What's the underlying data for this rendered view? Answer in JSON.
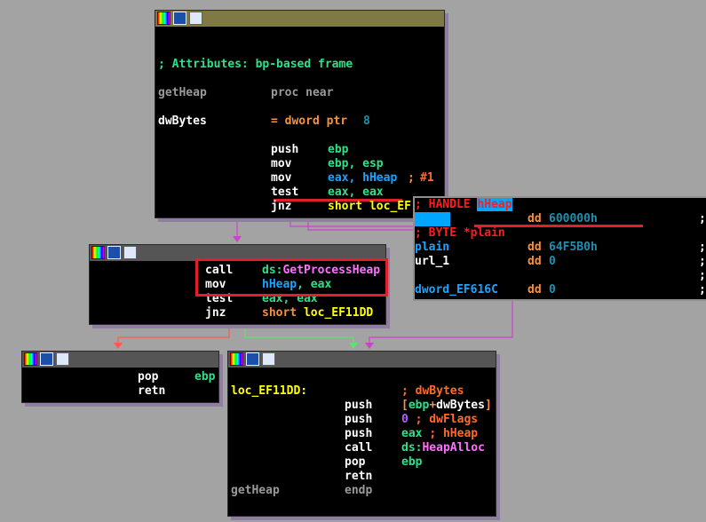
{
  "icons": [
    "color-palette-icon",
    "edit-pencil-icon",
    "graph-view-icon"
  ],
  "colors": {
    "background": "#a3a3a3",
    "node_title_active": "#7f7a45",
    "node_title": "#555555",
    "highlight_box": "#e0202a"
  },
  "node1": {
    "comment": "; Attributes: bp-based frame",
    "proc_name": "getHeap",
    "proc_kw": "proc near",
    "var": "dwBytes",
    "var_def": "= dword ptr",
    "var_off": "8",
    "lines": [
      [
        "push",
        "ebp"
      ],
      [
        "mov",
        "ebp, esp"
      ],
      [
        "mov",
        "eax, hHeap"
      ],
      [
        "test",
        "eax, eax"
      ],
      [
        "jnz",
        "short loc_EF"
      ]
    ],
    "cursor_comment": ";",
    "cursor_num": "#1"
  },
  "popup": {
    "c1": "; HANDLE",
    "c1_name": "hHeap",
    "dd": "dd",
    "v1": "600000h",
    "c2": "; BYTE *plain",
    "n2": "plain",
    "v2": "64F5B0h",
    "n3": "url_1",
    "v3": "0",
    "n4": "dword_EF616C",
    "v4": "0",
    "semi": ";"
  },
  "node3": {
    "lines": [
      [
        "call",
        "ds:",
        "GetProcessHeap"
      ],
      [
        "mov",
        "hHeap",
        ", eax"
      ],
      [
        "test",
        "eax, eax"
      ],
      [
        "jnz",
        "short ",
        "loc_EF11DD"
      ]
    ]
  },
  "node4": {
    "lines": [
      [
        "pop",
        "ebp"
      ],
      [
        "retn",
        ""
      ]
    ]
  },
  "node5": {
    "label": "loc_EF11DD:",
    "c_bytes": "; dwBytes",
    "push1": "push",
    "op1a": "[",
    "op1b": "ebp",
    "op1c": "+",
    "op1d": "dwBytes",
    "op1e": "]",
    "push2": "push",
    "op2": "0",
    "op2c": "; dwFlags",
    "push3": "push",
    "op3": "eax",
    "op3c": "; hHeap",
    "call": "call",
    "op4a": "ds:",
    "op4b": "HeapAlloc",
    "pop": "pop",
    "op5": "ebp",
    "retn": "retn",
    "end_name": "getHeap",
    "end_kw": "endp"
  }
}
